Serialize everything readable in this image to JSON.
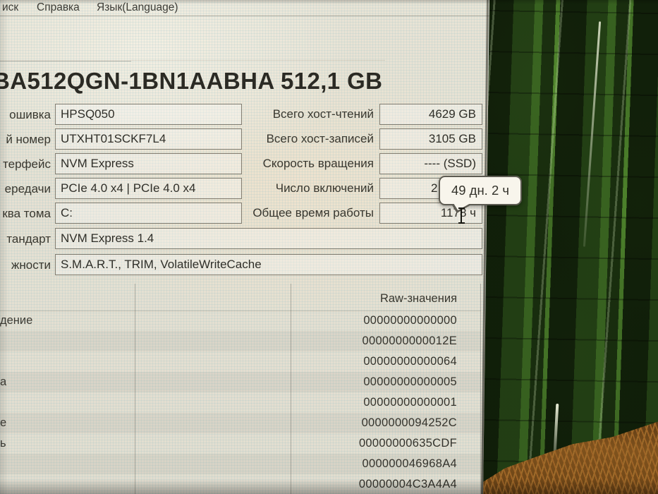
{
  "menu": {
    "items": [
      {
        "label": "иск",
        "note": "partially cropped menu name"
      },
      {
        "label": "Справка"
      },
      {
        "label": "Язык(Language)"
      }
    ]
  },
  "disk": {
    "title": "BA512QGN-1BN1AABHA 512,1 GB",
    "info_left": [
      {
        "label": "ошивка",
        "value": "HPSQ050"
      },
      {
        "label": "й номер",
        "value": "UTXHT01SCKF7L4"
      },
      {
        "label": "терфейс",
        "value": "NVM Express"
      },
      {
        "label": "ередачи",
        "value": "PCIe 4.0 x4 | PCIe 4.0 x4"
      },
      {
        "label": "ква тома",
        "value": "C:"
      },
      {
        "label": "тандарт",
        "value": "NVM Express 1.4"
      },
      {
        "label": "жности",
        "value": "S.M.A.R.T., TRIM, VolatileWriteCache"
      }
    ],
    "info_right": [
      {
        "label": "Всего хост-чтений",
        "value": "4629 GB"
      },
      {
        "label": "Всего хост-записей",
        "value": "3105 GB"
      },
      {
        "label": "Скорость вращения",
        "value": "---- (SSD)"
      },
      {
        "label": "Число включений",
        "value": "2"
      },
      {
        "label": "Общее время работы",
        "value": "1178 ч"
      }
    ]
  },
  "tooltip": {
    "text": "49 дн. 2 ч"
  },
  "smart": {
    "raw_header": "Raw-значения",
    "rows": [
      {
        "label": "дение",
        "raw": "00000000000000"
      },
      {
        "label": "",
        "raw": "0000000000012E"
      },
      {
        "label": "",
        "raw": "00000000000064"
      },
      {
        "label": "а",
        "raw": "00000000000005"
      },
      {
        "label": "",
        "raw": "00000000000001"
      },
      {
        "label": "е",
        "raw": "0000000094252C"
      },
      {
        "label": "ь",
        "raw": "00000000635CDF"
      },
      {
        "label": "",
        "raw": "000000046968A4"
      },
      {
        "label": "",
        "raw": "00000004C3A4A4"
      }
    ]
  },
  "colors": {
    "window_bg": "#e7e2d4",
    "bamboo_dark": "#16290c",
    "bamboo_bright": "#6fb83a",
    "grass_brown": "#8a5a20",
    "tooltip_bg": "#f8f5ec",
    "text": "#33322c"
  }
}
